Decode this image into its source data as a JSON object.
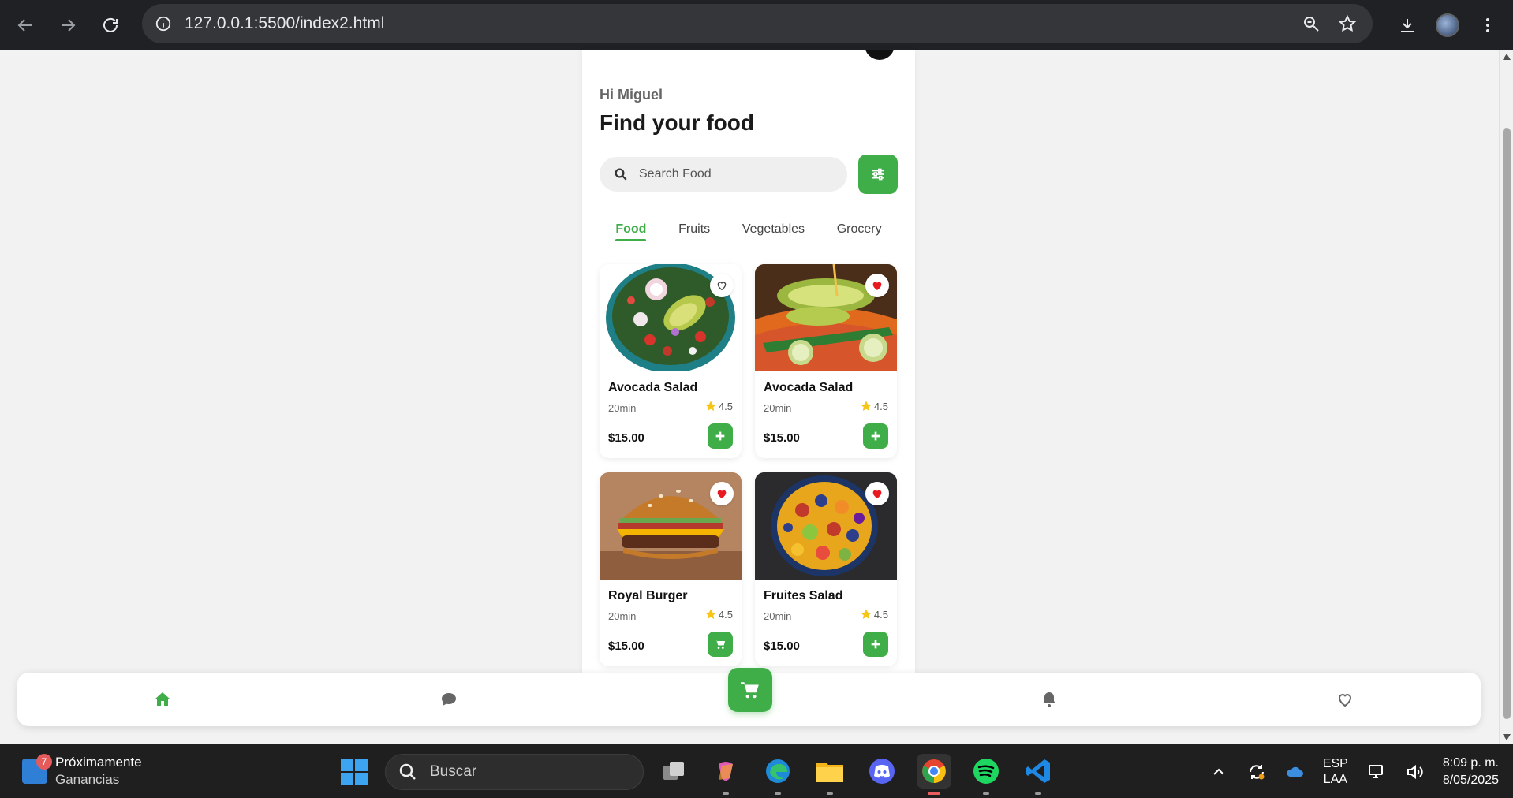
{
  "browser": {
    "url": "127.0.0.1:5500/index2.html"
  },
  "app": {
    "greeting": "Hi Miguel",
    "title": "Find your food",
    "search": {
      "placeholder": "Search Food"
    },
    "tabs": [
      {
        "label": "Food",
        "active": true
      },
      {
        "label": "Fruits",
        "active": false
      },
      {
        "label": "Vegetables",
        "active": false
      },
      {
        "label": "Grocery",
        "active": false
      }
    ],
    "cards": [
      {
        "name": "Avocada Salad",
        "time": "20min",
        "rating": "4.5",
        "price": "$15.00",
        "favorite": false,
        "action": "add"
      },
      {
        "name": "Avocada Salad",
        "time": "20min",
        "rating": "4.5",
        "price": "$15.00",
        "favorite": true,
        "action": "add"
      },
      {
        "name": "Royal Burger",
        "time": "20min",
        "rating": "4.5",
        "price": "$15.00",
        "favorite": true,
        "action": "cart"
      },
      {
        "name": "Fruites Salad",
        "time": "20min",
        "rating": "4.5",
        "price": "$15.00",
        "favorite": true,
        "action": "add"
      }
    ],
    "bottom_nav": [
      "home-icon",
      "chat-icon",
      "cart-icon",
      "bell-icon",
      "heart-icon"
    ],
    "colors": {
      "accent": "#3fae49",
      "favorite": "#e8191f",
      "star": "#f5c518"
    }
  },
  "taskbar": {
    "widget_badge": "7",
    "widget_title": "Próximamente",
    "widget_subtitle": "Ganancias",
    "search_label": "Buscar",
    "lang_line1": "ESP",
    "lang_line2": "LAA",
    "time": "8:09 p. m.",
    "date": "8/05/2025"
  }
}
